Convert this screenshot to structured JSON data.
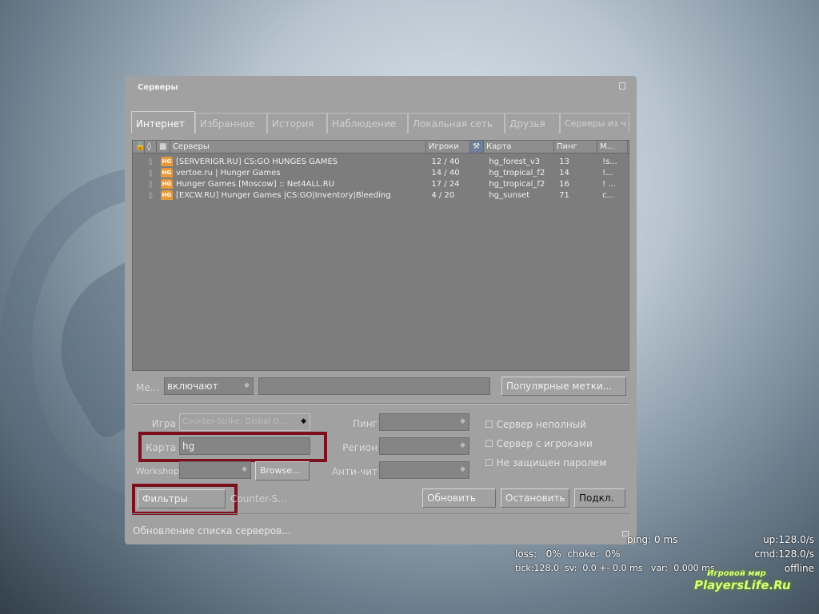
{
  "dialog": {
    "title": "Серверы"
  },
  "tabs": [
    "Интернет",
    "Избранное",
    "История",
    "Наблюдение",
    "Локальная сеть",
    "Друзья",
    "Серверы из ч"
  ],
  "columns": {
    "servers": "Серверы",
    "players": "Игроки",
    "map": "Карта",
    "ping": "Пинг",
    "more": "М..."
  },
  "servers": [
    {
      "name": "[SERVERIGR.RU] CS:GO HUNGES GAMES",
      "players": "12 / 40",
      "map": "hg_forest_v3",
      "ping": "13",
      "tags": "!s..."
    },
    {
      "name": "vertoe.ru | Hunger Games",
      "players": "14 / 40",
      "map": "hg_tropical_f2",
      "ping": "14",
      "tags": "!..."
    },
    {
      "name": "Hunger Games [Moscow] :: Net4ALL.RU",
      "players": "17 / 24",
      "map": "hg_tropical_f2",
      "ping": "16",
      "tags": "! ..."
    },
    {
      "name": "[EXCW.RU] Hunger Games |CS:GO|Inventory|Bleeding",
      "players": "4 / 20",
      "map": "hg_sunset",
      "ping": "71",
      "tags": "c..."
    }
  ],
  "hg_badge": "HG",
  "filters": {
    "tags_label": "Ме...",
    "tags_mode": "включают",
    "popular_tags": "Популярные метки...",
    "game_label": "Игра",
    "game_value": "Counter-Strike: Global O...",
    "map_label": "Карта",
    "map_value": "hg",
    "workshop_label": "Workshop",
    "browse": "Browse...",
    "ping_label": "Пинг",
    "region_label": "Регион",
    "anticheat_label": "Анти-чит",
    "not_full": "Сервер неполный",
    "has_players": "Сервер с игроками",
    "no_password": "Не защищен паролем"
  },
  "buttons": {
    "filters": "Фильтры",
    "game_short": "Counter-S...",
    "refresh": "Обновить",
    "stop": "Остановить",
    "connect": "Подкл."
  },
  "status": "Обновление списка серверов...",
  "netgraph": {
    "ping": "ping: 0 ms",
    "up": "up:128.0/s",
    "loss": "loss:   0%  choke:  0%",
    "cmd": "cmd:128.0/s",
    "tick": "tick:128.0  sv:  0.0 +- 0.0 ms   var:  0.000 ms",
    "state": "offline"
  },
  "watermark": {
    "line1": "Игровой мир",
    "line2": "PlayersLife.Ru"
  }
}
